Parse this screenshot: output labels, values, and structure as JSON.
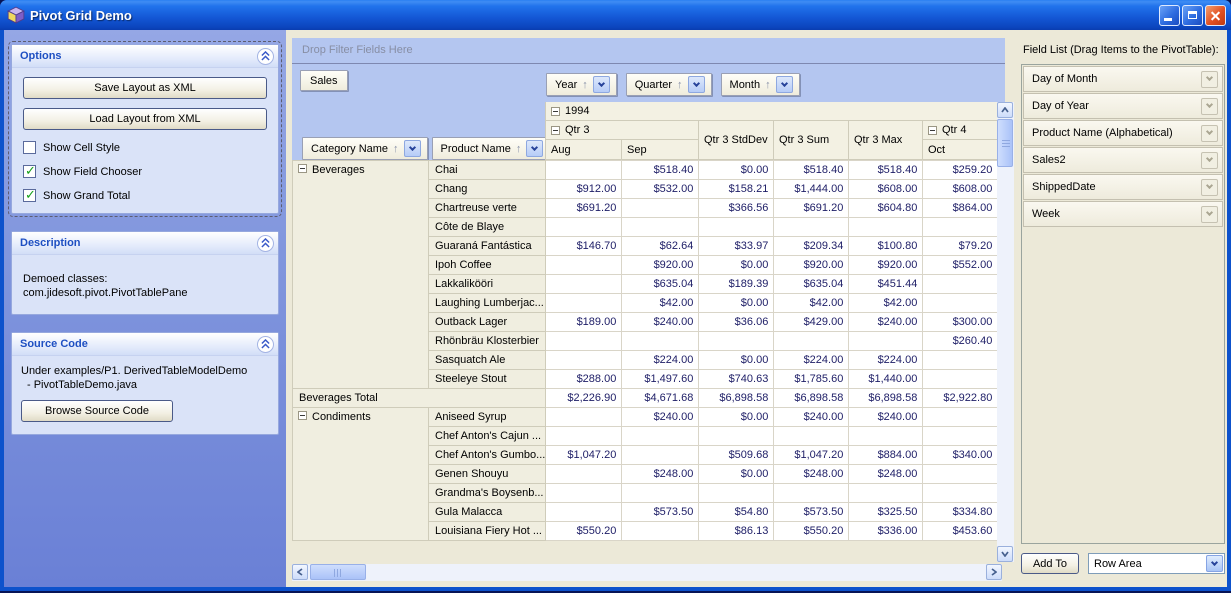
{
  "window": {
    "title": "Pivot Grid Demo"
  },
  "sidebar": {
    "options": {
      "title": "Options",
      "buttons": [
        "Save Layout as XML",
        "Load Layout from XML"
      ],
      "checkboxes": [
        {
          "label": "Show Cell Style",
          "checked": false
        },
        {
          "label": "Show Field Chooser",
          "checked": true
        },
        {
          "label": "Show Grand Total",
          "checked": true
        }
      ]
    },
    "description": {
      "title": "Description",
      "lines": [
        "Demoed classes:",
        "com.jidesoft.pivot.PivotTablePane"
      ]
    },
    "source_code": {
      "title": "Source Code",
      "lines": [
        "Under examples/P1. DerivedTableModelDemo",
        "- PivotTableDemo.java"
      ],
      "button": "Browse Source Code"
    }
  },
  "pivot": {
    "drop_filter_label": "Drop Filter Fields Here",
    "data_field": "Sales",
    "column_fields": [
      "Year",
      "Quarter",
      "Month"
    ],
    "row_fields": [
      "Category Name",
      "Product Name"
    ],
    "col_header_cells": [
      {
        "label": "1994",
        "row": 1,
        "col": 1,
        "colspan": 6,
        "rowspan": 1,
        "collapse": true
      },
      {
        "label": "Qtr 3",
        "row": 2,
        "col": 1,
        "colspan": 2,
        "rowspan": 1,
        "collapse": true
      },
      {
        "label": "Qtr 3 StdDev",
        "row": 2,
        "col": 3,
        "colspan": 1,
        "rowspan": 2,
        "collapse": false
      },
      {
        "label": "Qtr 3 Sum",
        "row": 2,
        "col": 4,
        "colspan": 1,
        "rowspan": 2,
        "collapse": false
      },
      {
        "label": "Qtr 3 Max",
        "row": 2,
        "col": 5,
        "colspan": 1,
        "rowspan": 2,
        "collapse": false
      },
      {
        "label": "Qtr 4",
        "row": 2,
        "col": 6,
        "colspan": 1,
        "rowspan": 1,
        "collapse": true
      },
      {
        "label": "Aug",
        "row": 3,
        "col": 1,
        "colspan": 1,
        "rowspan": 1,
        "collapse": false
      },
      {
        "label": "Sep",
        "row": 3,
        "col": 2,
        "colspan": 1,
        "rowspan": 1,
        "collapse": false
      },
      {
        "label": "Oct",
        "row": 3,
        "col": 6,
        "colspan": 1,
        "rowspan": 1,
        "collapse": false
      }
    ],
    "value_columns": [
      "Aug",
      "Sep",
      "Qtr 3 StdDev",
      "Qtr 3 Sum",
      "Qtr 3 Max",
      "Oct"
    ],
    "rows": [
      {
        "category": "Beverages",
        "category_span": 12,
        "product": "Chai",
        "values": [
          "",
          "$518.40",
          "$0.00",
          "$518.40",
          "$518.40",
          "$259.20"
        ]
      },
      {
        "product": "Chang",
        "values": [
          "$912.00",
          "$532.00",
          "$158.21",
          "$1,444.00",
          "$608.00",
          "$608.00"
        ]
      },
      {
        "product": "Chartreuse verte",
        "values": [
          "$691.20",
          "",
          "$366.56",
          "$691.20",
          "$604.80",
          "$864.00"
        ]
      },
      {
        "product": "Côte de Blaye",
        "values": [
          "",
          "",
          "",
          "",
          "",
          ""
        ]
      },
      {
        "product": "Guaraná Fantástica",
        "values": [
          "$146.70",
          "$62.64",
          "$33.97",
          "$209.34",
          "$100.80",
          "$79.20"
        ]
      },
      {
        "product": "Ipoh Coffee",
        "values": [
          "",
          "$920.00",
          "$0.00",
          "$920.00",
          "$920.00",
          "$552.00"
        ]
      },
      {
        "product": "Lakkalikööri",
        "values": [
          "",
          "$635.04",
          "$189.39",
          "$635.04",
          "$451.44",
          ""
        ]
      },
      {
        "product": "Laughing Lumberjac...",
        "values": [
          "",
          "$42.00",
          "$0.00",
          "$42.00",
          "$42.00",
          ""
        ]
      },
      {
        "product": "Outback Lager",
        "values": [
          "$189.00",
          "$240.00",
          "$36.06",
          "$429.00",
          "$240.00",
          "$300.00"
        ]
      },
      {
        "product": "Rhönbräu Klosterbier",
        "values": [
          "",
          "",
          "",
          "",
          "",
          "$260.40"
        ]
      },
      {
        "product": "Sasquatch Ale",
        "values": [
          "",
          "$224.00",
          "$0.00",
          "$224.00",
          "$224.00",
          ""
        ]
      },
      {
        "product": "Steeleye Stout",
        "values": [
          "$288.00",
          "$1,497.60",
          "$740.63",
          "$1,785.60",
          "$1,440.00",
          ""
        ]
      },
      {
        "total": "Beverages Total",
        "values": [
          "$2,226.90",
          "$4,671.68",
          "$6,898.58",
          "$6,898.58",
          "$6,898.58",
          "$2,922.80"
        ]
      },
      {
        "category": "Condiments",
        "category_span": 7,
        "product": "Aniseed Syrup",
        "values": [
          "",
          "$240.00",
          "$0.00",
          "$240.00",
          "$240.00",
          ""
        ]
      },
      {
        "product": "Chef Anton's Cajun ...",
        "values": [
          "",
          "",
          "",
          "",
          "",
          ""
        ]
      },
      {
        "product": "Chef Anton's Gumbo...",
        "values": [
          "$1,047.20",
          "",
          "$509.68",
          "$1,047.20",
          "$884.00",
          "$340.00"
        ]
      },
      {
        "product": "Genen Shouyu",
        "values": [
          "",
          "$248.00",
          "$0.00",
          "$248.00",
          "$248.00",
          ""
        ]
      },
      {
        "product": "Grandma's Boysenb...",
        "values": [
          "",
          "",
          "",
          "",
          "",
          ""
        ]
      },
      {
        "product": "Gula Malacca",
        "values": [
          "",
          "$573.50",
          "$54.80",
          "$573.50",
          "$325.50",
          "$334.80"
        ]
      },
      {
        "product": "Louisiana Fiery Hot ...",
        "values": [
          "$550.20",
          "",
          "$86.13",
          "$550.20",
          "$336.00",
          "$453.60"
        ]
      }
    ]
  },
  "field_list": {
    "title": "Field List (Drag Items to the PivotTable):",
    "items": [
      "Day of Month",
      "Day of Year",
      "Product Name (Alphabetical)",
      "Sales2",
      "ShippedDate",
      "Week"
    ],
    "add_button": "Add To",
    "area_select": "Row Area"
  },
  "colors": {
    "titlebar_blue": "#1356d4",
    "sidebar_blue": "#7b90db",
    "zone_blue": "#b4c6f0",
    "header_cream": "#f3f1e3",
    "value_text": "#1d1d66"
  }
}
